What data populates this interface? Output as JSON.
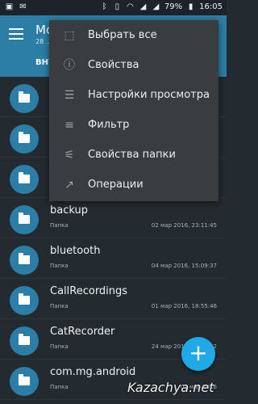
{
  "statusbar": {
    "battery": "79%",
    "time": "16:05",
    "icons_left": [
      "image-icon",
      "mail-icon"
    ],
    "icons_right": [
      "bluetooth-icon",
      "vibrate-icon",
      "wifi-icon",
      "signal-icon",
      "signal-icon"
    ]
  },
  "appbar": {
    "title": "Mo",
    "subtitle": "28 ...",
    "tab": "ВНУ"
  },
  "menu": {
    "items": [
      {
        "icon": "select-all-icon",
        "label": "Выбрать все"
      },
      {
        "icon": "info-icon",
        "label": "Свойства"
      },
      {
        "icon": "view-settings-icon",
        "label": "Настройки просмотра"
      },
      {
        "icon": "filter-icon",
        "label": "Фильтр"
      },
      {
        "icon": "folder-properties-icon",
        "label": "Свойства папки"
      },
      {
        "icon": "operations-icon",
        "label": "Операции"
      }
    ]
  },
  "rows": [
    {
      "name": "",
      "type": "",
      "date": ""
    },
    {
      "name": "",
      "type": "",
      "date": ""
    },
    {
      "name": "",
      "type": "",
      "date": ""
    },
    {
      "name": "backup",
      "type": "Папка",
      "date": "02 мар 2016, 23:11:45"
    },
    {
      "name": "bluetooth",
      "type": "Папка",
      "date": "04 мар 2016, 15:09:37"
    },
    {
      "name": "CallRecordings",
      "type": "Папка",
      "date": "01 мар 2016, 18:55:46"
    },
    {
      "name": "CatRecorder",
      "type": "Папка",
      "date": "24 мар 2016, 07:53:22"
    },
    {
      "name": "com.mg.android",
      "type": "Папка",
      "date": "02 мар 2016"
    }
  ],
  "fab": {
    "label": "+"
  },
  "watermark": "Kazachya.net"
}
